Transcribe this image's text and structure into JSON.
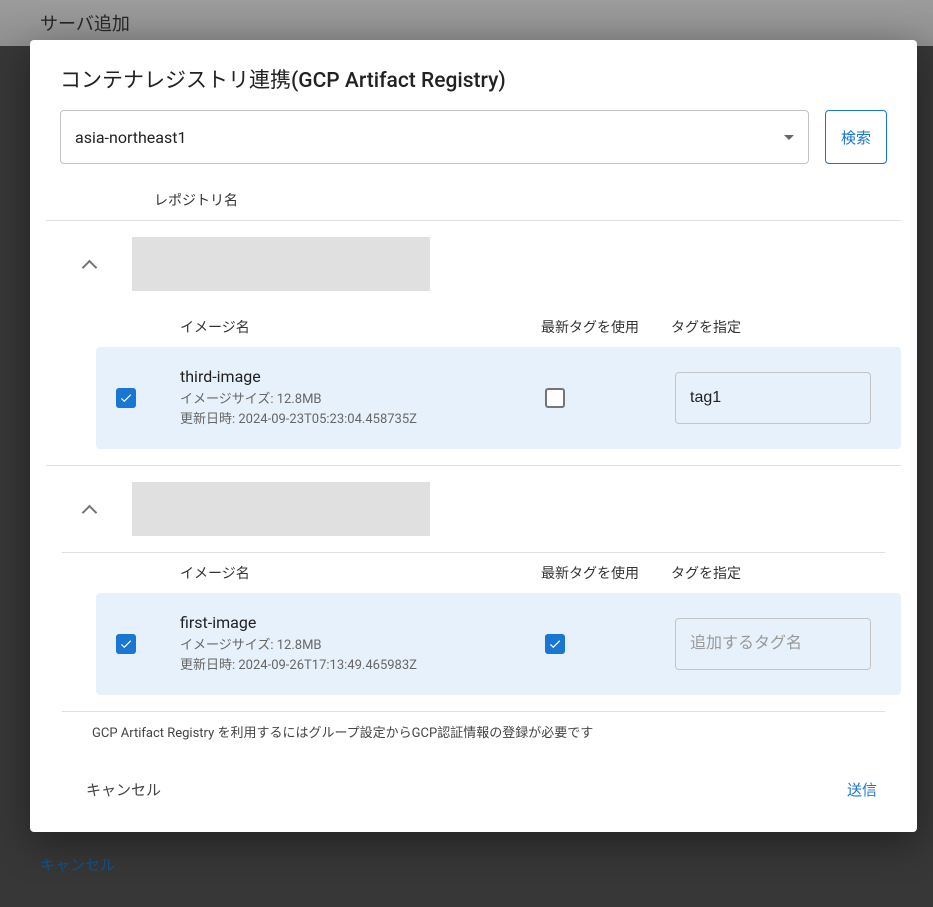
{
  "backdrop": {
    "title": "サーバ追加",
    "cancel": "キャンセル"
  },
  "modal": {
    "title": "コンテナレジストリ連携(GCP Artifact Registry)",
    "region": "asia-northeast1",
    "search_button": "検索",
    "repo_column_label": "レポジトリ名",
    "image_headers": {
      "name": "イメージ名",
      "latest": "最新タグを使用",
      "tag": "タグを指定"
    },
    "repos": [
      {
        "expanded": true,
        "images": [
          {
            "checked": true,
            "name": "third-image",
            "size_label": "イメージサイズ: 12.8MB",
            "updated_label": "更新日時: 2024-09-23T05:23:04.458735Z",
            "use_latest": false,
            "tag_value": "tag1",
            "tag_placeholder": "追加するタグ名"
          }
        ]
      },
      {
        "expanded": true,
        "images": [
          {
            "checked": true,
            "name": "first-image",
            "size_label": "イメージサイズ: 12.8MB",
            "updated_label": "更新日時: 2024-09-26T17:13:49.465983Z",
            "use_latest": true,
            "tag_value": "",
            "tag_placeholder": "追加するタグ名"
          }
        ]
      }
    ],
    "footnote": "GCP Artifact Registry を利用するにはグループ設定からGCP認証情報の登録が必要です",
    "cancel": "キャンセル",
    "submit": "送信"
  }
}
